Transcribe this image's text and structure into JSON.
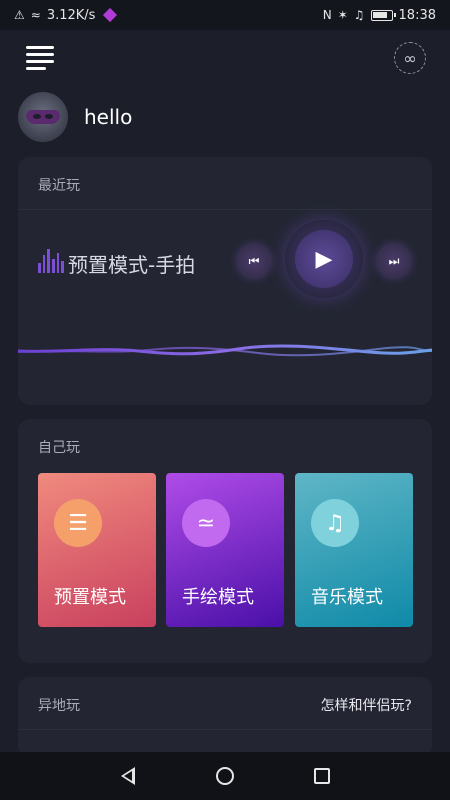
{
  "status_bar": {
    "network_speed": "3.12K/s",
    "time": "18:38"
  },
  "profile": {
    "username": "hello"
  },
  "recent_card": {
    "title": "最近玩",
    "current_mode": "预置模式-手拍"
  },
  "self_card": {
    "title": "自己玩",
    "modes": [
      {
        "label": "预置模式",
        "icon": "equalizer-icon"
      },
      {
        "label": "手绘模式",
        "icon": "draw-icon"
      },
      {
        "label": "音乐模式",
        "icon": "music-note-icon"
      }
    ]
  },
  "remote_card": {
    "title": "异地玩",
    "help_link": "怎样和伴侣玩?"
  },
  "colors": {
    "background": "#1c1f2a",
    "card": "#232632",
    "accent_purple": "#7b4fd6"
  }
}
